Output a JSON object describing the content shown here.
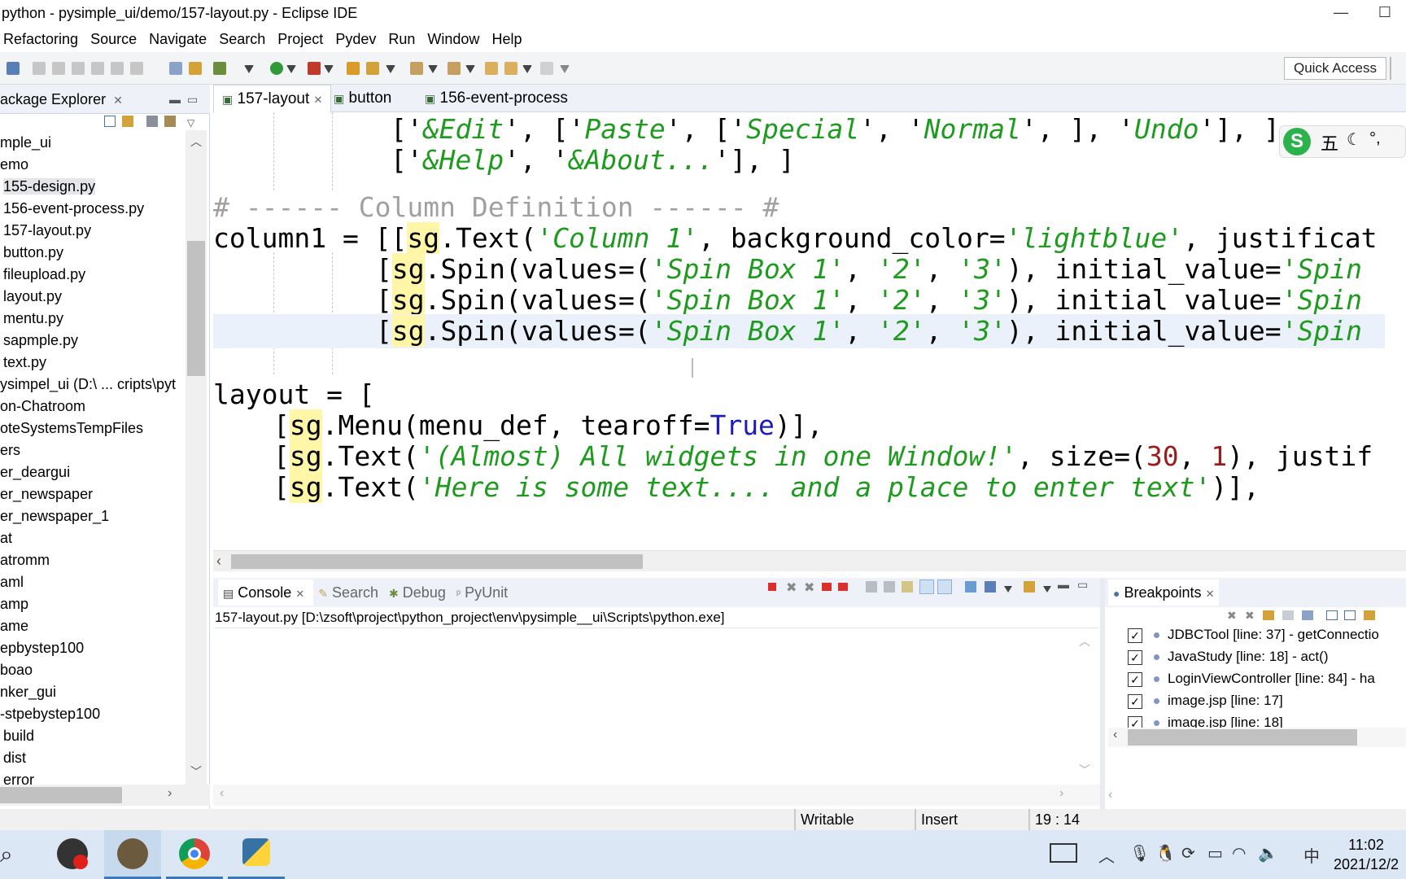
{
  "window": {
    "title": "python - pysimple_ui/demo/157-layout.py - Eclipse IDE",
    "minimize": "—",
    "maximize": "☐"
  },
  "menu": [
    "Refactoring",
    "Source",
    "Navigate",
    "Search",
    "Project",
    "Pydev",
    "Run",
    "Window",
    "Help"
  ],
  "toolbar": {
    "quick_access": "Quick Access"
  },
  "package_explorer": {
    "title": "ackage Explorer",
    "items": [
      "mple_ui",
      "emo",
      "155-design.py",
      "156-event-process.py",
      "157-layout.py",
      "button.py",
      "fileupload.py",
      "layout.py",
      "mentu.py",
      "sapmple.py",
      "text.py",
      "ysimpel_ui  (D:\\ ... cripts\\pyt",
      "on-Chatroom",
      "oteSystemsTempFiles",
      "ers",
      "er_deargui",
      "er_newspaper",
      "er_newspaper_1",
      "at",
      "atromm",
      "aml",
      "amp",
      "ame",
      "epbystep100",
      "boao",
      "nker_gui",
      "-stpebystep100",
      "build",
      "dist",
      "error"
    ],
    "selected_index": 2
  },
  "editor": {
    "tabs": [
      {
        "label": "157-layout",
        "active": true
      },
      {
        "label": "button",
        "active": false
      },
      {
        "label": "156-event-process",
        "active": false
      }
    ],
    "code_lines": [
      [
        "['",
        "&Edit",
        "', ['",
        "Paste",
        "', ['",
        "Special",
        "', '",
        "Normal",
        "', ], '",
        "Undo",
        "'], ]"
      ],
      [
        "['",
        "&Help",
        "', '",
        "&About...",
        "'], ]"
      ],
      [
        "# ------ Column Definition ------ #"
      ],
      [
        "column1 = [[sg.Text(",
        "'Column 1'",
        ", background_color=",
        "'lightblue'",
        ", justificat"
      ],
      [
        "[sg.Spin(values=(",
        "'Spin Box 1'",
        ", ",
        "'2'",
        ", ",
        "'3'",
        "), initial_value=",
        "'Spin"
      ],
      [
        "[sg.Spin(values=(",
        "'Spin Box 1'",
        ", ",
        "'2'",
        ", ",
        "'3'",
        "), initial_value=",
        "'Spin"
      ],
      [
        "[sg.Spin(values=(",
        "'Spin Box 1'",
        ", ",
        "'2'",
        ", ",
        "'3'",
        "), initial_value=",
        "'Spin"
      ],
      [
        "layout = ["
      ],
      [
        "[sg.Menu(menu_def, tearoff=",
        "True",
        ")],"
      ],
      [
        "[sg.Text(",
        "'(Almost) All widgets in one Window!'",
        ", size=(",
        "30",
        ", ",
        "1",
        "), justif"
      ],
      [
        "[sg.Text(",
        "'Here is some text.... and a place to enter text'",
        ")],"
      ]
    ]
  },
  "console": {
    "tabs": [
      "Console",
      "Search",
      "Debug",
      "PyUnit"
    ],
    "path": "157-layout.py [D:\\zsoft\\project\\python_project\\env\\pysimple__ui\\Scripts\\python.exe]"
  },
  "breakpoints": {
    "title": "Breakpoints",
    "items": [
      "JDBCTool [line: 37] - getConnectio",
      "JavaStudy [line: 18] - act()",
      "LoginViewController [line: 84] - ha",
      "image.jsp [line: 17]",
      "image.jsp [line: 18]"
    ]
  },
  "statusbar": {
    "writable": "Writable",
    "insert": "Insert",
    "position": "19 : 14"
  },
  "taskbar": {
    "time": "11:02",
    "date": "2021/12/2",
    "ime": "中"
  },
  "ime_toolbar": {
    "label": "五",
    "extra": "°,",
    "letter": "S"
  },
  "colors": {
    "string": "#1e9b1e",
    "comment": "#a0a0a0",
    "constant": "#1d1db8",
    "occurrence": "#fff6a8",
    "current_line": "#eaf1fb"
  }
}
